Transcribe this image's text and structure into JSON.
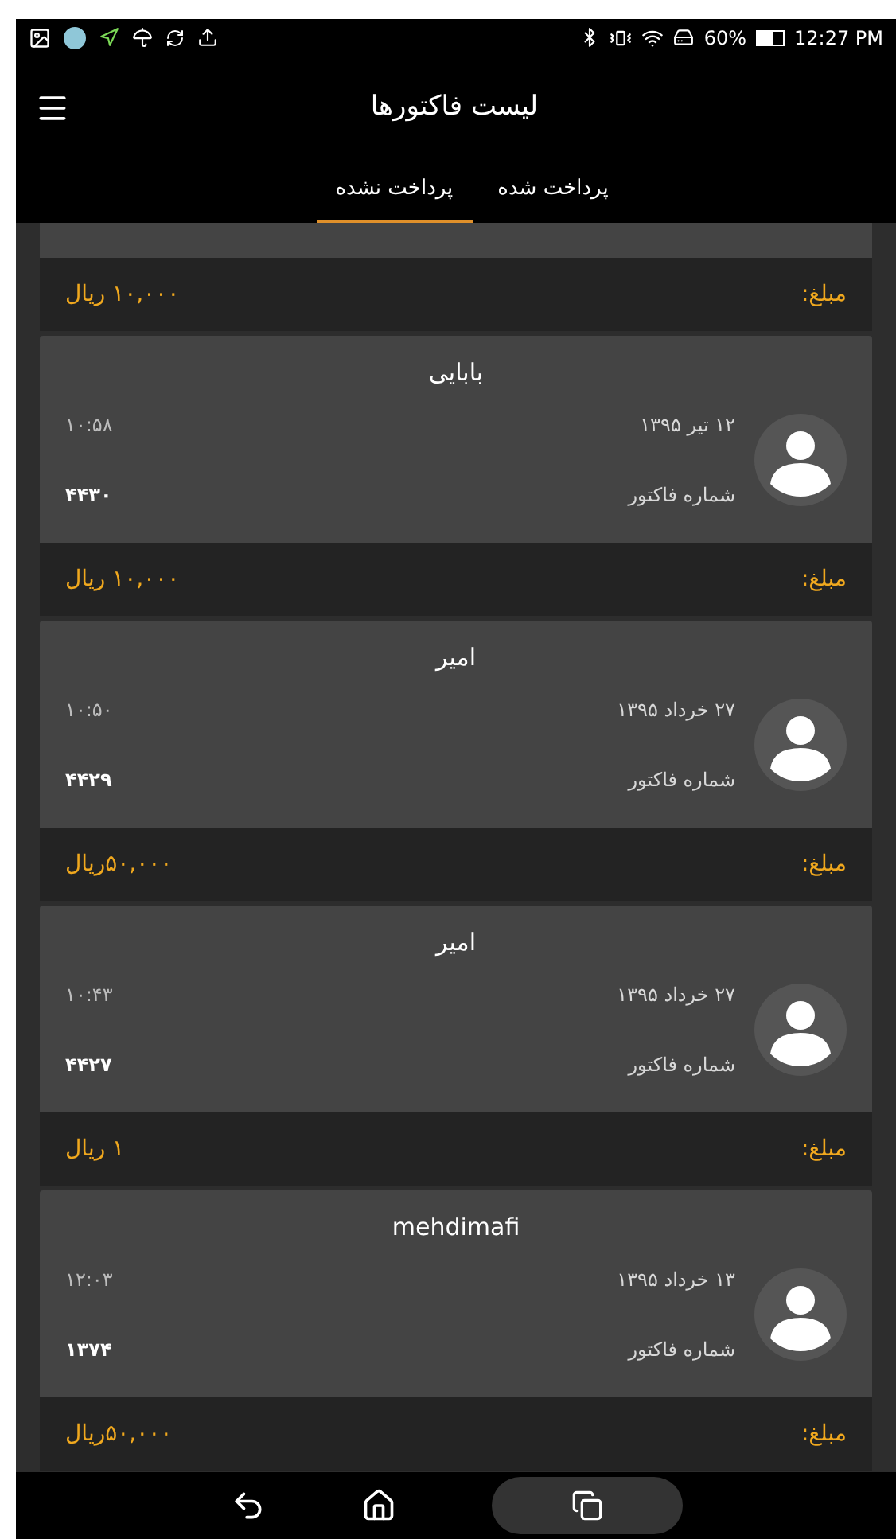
{
  "status_bar": {
    "battery": "60%",
    "time": "12:27 PM"
  },
  "app_bar": {
    "title": "لیست فاکتورها"
  },
  "tabs": [
    {
      "label": "پرداخت شده",
      "selected": false
    },
    {
      "label": "پرداخت نشده",
      "selected": true
    }
  ],
  "partial_invoice": {
    "amount_label": "مبلغ:",
    "amount": "۱۰,۰۰۰ ریال"
  },
  "invoices": [
    {
      "name": "بابایی",
      "date": "۱۲ تیر ۱۳۹۵",
      "time": "۱۰:۵۸",
      "number_label": "شماره فاکتور",
      "number": "۴۴۳۰",
      "amount_label": "مبلغ:",
      "amount": "۱۰,۰۰۰ ریال"
    },
    {
      "name": "امیر",
      "date": "۲۷ خرداد ۱۳۹۵",
      "time": "۱۰:۵۰",
      "number_label": "شماره فاکتور",
      "number": "۴۴۲۹",
      "amount_label": "مبلغ:",
      "amount": "۵۰,۰۰۰ریال"
    },
    {
      "name": "امیر",
      "date": "۲۷ خرداد ۱۳۹۵",
      "time": "۱۰:۴۳",
      "number_label": "شماره فاکتور",
      "number": "۴۴۲۷",
      "amount_label": "مبلغ:",
      "amount": "۱ ریال"
    },
    {
      "name": "mehdimafi",
      "date": "۱۳ خرداد ۱۳۹۵",
      "time": "۱۲:۰۳",
      "number_label": "شماره فاکتور",
      "number": "۱۳۷۴",
      "amount_label": "مبلغ:",
      "amount": "۵۰,۰۰۰ریال"
    }
  ]
}
